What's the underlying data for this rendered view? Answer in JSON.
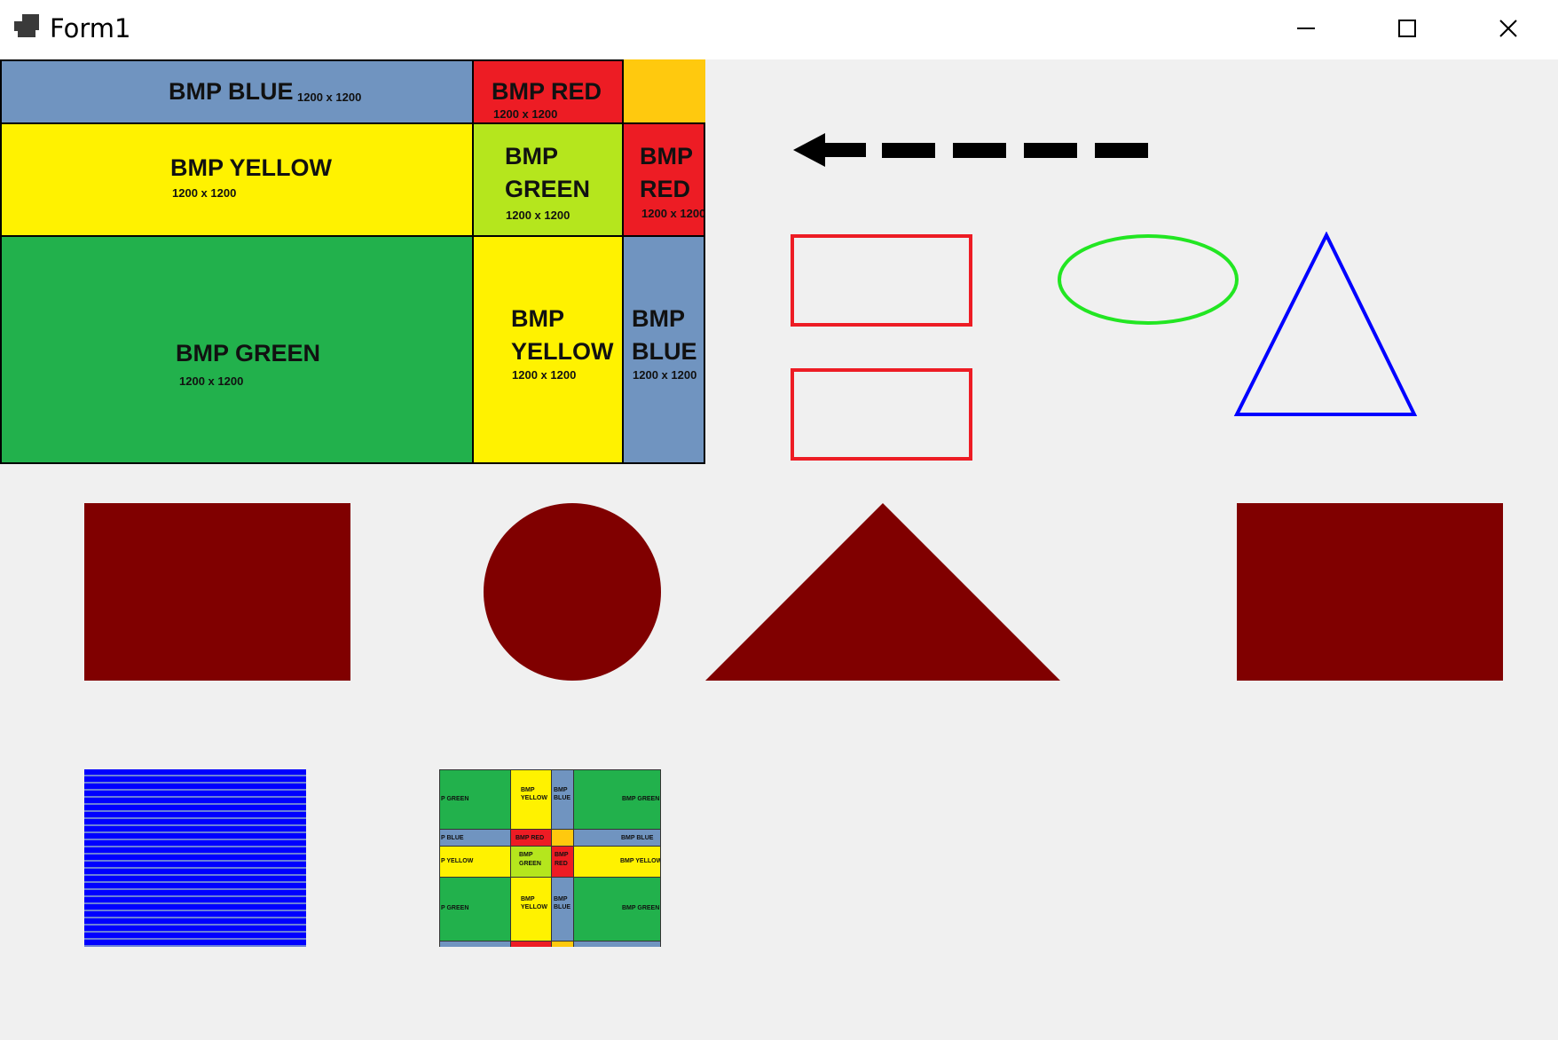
{
  "window": {
    "title": "Form1",
    "controls": {
      "minimize": "minimize-icon",
      "maximize": "maximize-icon",
      "close": "close-icon"
    }
  },
  "colors": {
    "blue": "#7094c0",
    "red": "#ed1c24",
    "orange": "#ffc90e",
    "yellow": "#fff200",
    "lime": "#b5e61d",
    "green": "#22b14c",
    "dark_red": "#800000",
    "outline_red": "#ed1c24",
    "outline_green": "#22e622",
    "outline_blue": "#0000ff",
    "stripe_blue": "#0000ff"
  },
  "tiles": {
    "blue_top": {
      "label": "BMP BLUE",
      "size": "1200 x 1200"
    },
    "red_top": {
      "label": "BMP RED",
      "size": "1200 x 1200"
    },
    "yellow_mid": {
      "label": "BMP YELLOW",
      "size": "1200 x 1200"
    },
    "green_small": {
      "label1": "BMP",
      "label2": "GREEN",
      "size": "1200 x 1200"
    },
    "red_small": {
      "label1": "BMP",
      "label2": "RED",
      "size": "1200 x 1200"
    },
    "green_big": {
      "label": "BMP GREEN",
      "size": "1200 x 1200"
    },
    "yellow_tall": {
      "label1": "BMP",
      "label2": "YELLOW",
      "size": "1200 x 1200"
    },
    "blue_tall": {
      "label1": "BMP",
      "label2": "BLUE",
      "size": "1200 x 1200"
    }
  },
  "thumbnail": {
    "labels": {
      "green": "BMP GREEN",
      "green_cut": "P GREEN",
      "yellow": "BMP YELLOW",
      "yellow_cut": "P YELLOW",
      "blue": "BMP BLUE",
      "blue_cut": "P BLUE",
      "red": "BMP RED",
      "bmp": "BMP",
      "yellow_word": "YELLOW",
      "green_word": "GREEN",
      "blue_word": "BLUE",
      "red_word": "RED"
    }
  }
}
